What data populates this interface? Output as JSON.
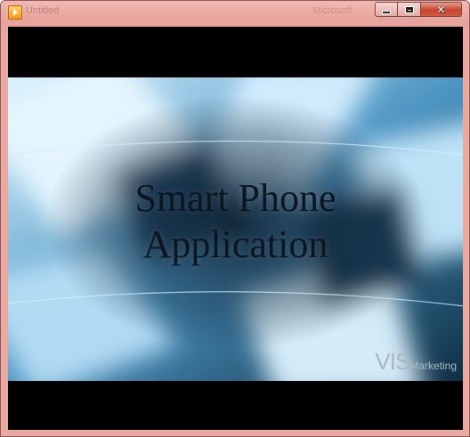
{
  "window": {
    "title": "Untitled",
    "title_right": "Microsoft",
    "controls": {
      "minimize": "minimize",
      "maximize": "maximize",
      "close": "✕"
    },
    "frame_color": "#e9a8a0"
  },
  "video": {
    "slide_title_line1": "Smart Phone",
    "slide_title_line2": "Application",
    "watermark_brand": "VIS",
    "watermark_suffix": "Marketing",
    "background_color": "#000000",
    "accent_colors": [
      "#0d2a3d",
      "#3f86b3",
      "#d9f1ff"
    ]
  }
}
